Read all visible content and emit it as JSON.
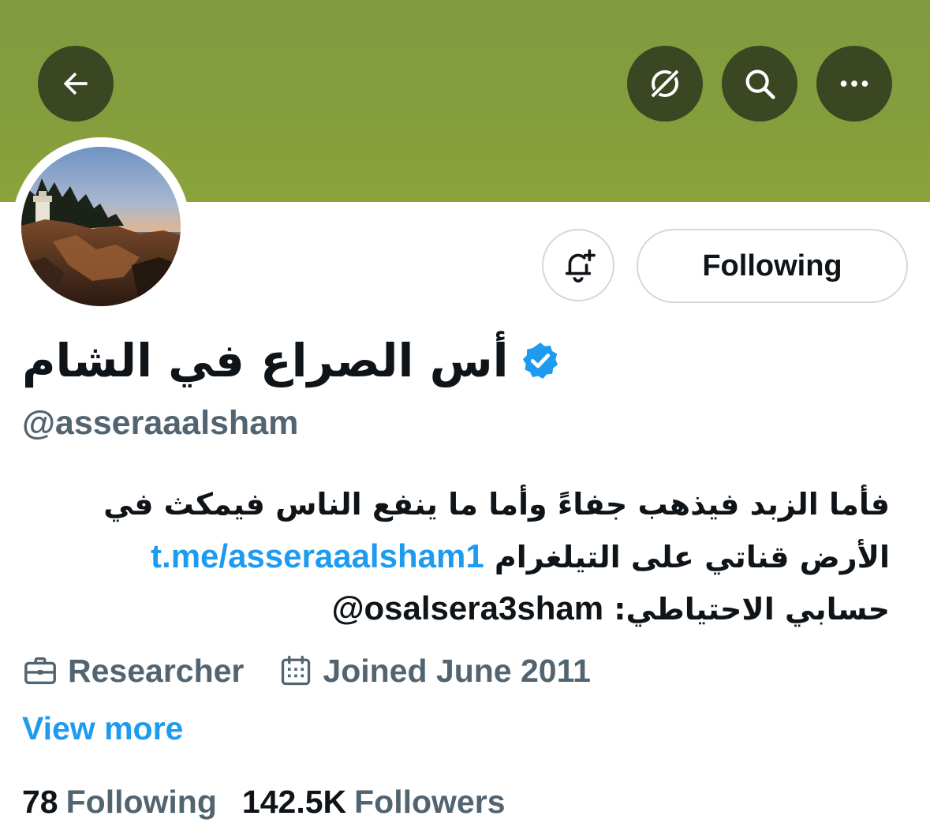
{
  "header": {
    "back_icon": "arrow-left-icon",
    "grok_icon": "grok-icon",
    "search_icon": "search-icon",
    "more_icon": "more-dots-icon",
    "banner_color": "#849d3d"
  },
  "profile": {
    "display_name": "أس الصراع في الشام",
    "verified": true,
    "handle": "@asseraaalsham",
    "bio": {
      "line1": "فأما الزبد فيذهب جفاءً وأما ما ينفع الناس فيمكث في",
      "line2_text": "الأرض قناتي على التيلغرام",
      "line2_link": "t.me/asseraaalsham1",
      "line3_text": "حسابي الاحتياطي:",
      "line3_mention": "@osalsera3sham"
    },
    "profession": "Researcher",
    "joined": "Joined June 2011",
    "view_more": "View more"
  },
  "actions": {
    "notify_icon": "bell-plus-icon",
    "following_label": "Following"
  },
  "stats": {
    "following_count": "78",
    "following_label": "Following",
    "followers_count": "142.5K",
    "followers_label": "Followers"
  },
  "colors": {
    "accent": "#1d9bf0",
    "secondary_text": "#536471",
    "primary_text": "#0f1419",
    "button_dark": "#3b4622"
  }
}
